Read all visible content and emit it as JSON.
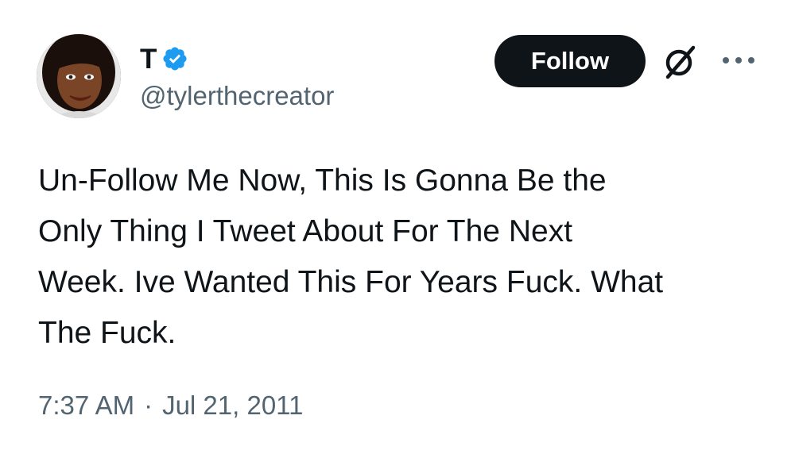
{
  "author": {
    "display_name": "T",
    "handle": "@tylerthecreator",
    "verified": true,
    "verified_color": "#1d9bf0"
  },
  "actions": {
    "follow_label": "Follow",
    "grok_icon": "grok-icon",
    "more_icon": "more-icon"
  },
  "tweet": {
    "text": "Un-Follow Me Now, This Is Gonna Be the\nOnly Thing I Tweet About For The Next\nWeek. Ive Wanted This For Years Fuck. What\nThe Fuck.",
    "time": "7:37 AM",
    "separator": "·",
    "date": "Jul 21, 2011"
  },
  "colors": {
    "text_primary": "#0f1419",
    "text_secondary": "#536471",
    "button_bg": "#0f1419",
    "button_text": "#ffffff"
  }
}
